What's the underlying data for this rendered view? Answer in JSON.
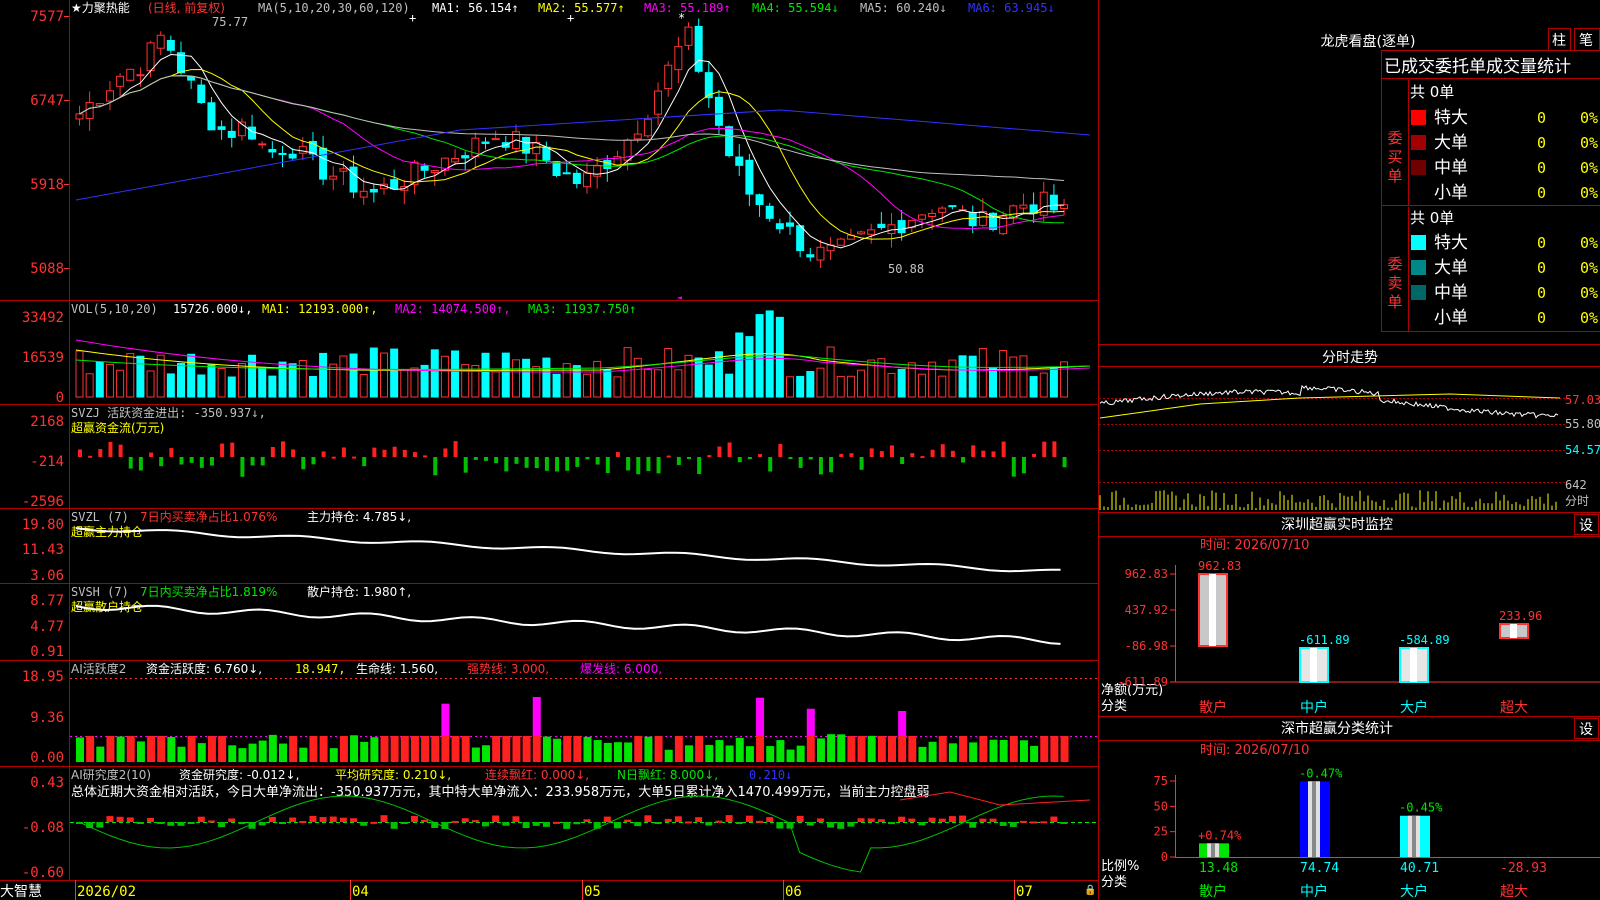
{
  "app": {
    "brand": "大智慧"
  },
  "colors": {
    "up": "#ff3232",
    "down": "#00ffff",
    "green": "#00e600",
    "white": "#ffffff",
    "yellow": "#ffff00",
    "magenta": "#ff00ff",
    "blue": "#3232ff",
    "gray": "#c0c0c0",
    "frame": "#b00000"
  },
  "header": {
    "title": "★力聚热能",
    "mode": "(日线, 前复权)",
    "ma_prefix": "MA(5,10,20,30,60,120)",
    "ma1": "MA1: 56.154↑",
    "ma2": "MA2: 55.577↑",
    "ma3": "MA3: 55.189↑",
    "ma4": "MA4: 55.594↓",
    "ma5": "MA5: 60.240↓",
    "ma6": "MA6: 63.945↓"
  },
  "price_axis": [
    "7577",
    "6747",
    "5918",
    "5088"
  ],
  "price_markers": {
    "high": "75.77",
    "low": "50.88"
  },
  "vol": {
    "axis": [
      "33492",
      "16539",
      "0"
    ],
    "label": "VOL(5,10,20)",
    "value": "15726.000↓,",
    "ma1": "MA1: 12193.000↑,",
    "ma2": "MA2: 14074.500↑,",
    "ma3": "MA3: 11937.750↑"
  },
  "svzj": {
    "axis": [
      "2168",
      "-214",
      "-2596"
    ],
    "label": "SVZJ  活跃资金进出: -350.937↓,",
    "subtitle": "超赢资金流(万元)"
  },
  "svzl": {
    "axis": [
      "19.80",
      "11.43",
      "3.06"
    ],
    "prefix": "SVZL (7)",
    "ratio": "7日内买卖净占比1.076%",
    "holding": "主力持仓: 4.785↓,",
    "subtitle": "超赢主力持仓"
  },
  "svsh": {
    "axis": [
      "8.77",
      "4.77",
      "0.91"
    ],
    "prefix": "SVSH (7)",
    "ratio": "7日内买卖净占比1.819%",
    "holding": "散户持仓: 1.980↑,",
    "subtitle": "超赢散户持仓"
  },
  "ai_active": {
    "axis": [
      "18.95",
      "9.36",
      "0.00"
    ],
    "prefix": "AI活跃度2",
    "v1": "资金活跃度: 6.760↓,",
    "v2": "18.947,",
    "v3": "生命线: 1.560,",
    "v4": "强势线: 3.000,",
    "v5": "爆发线: 6.000,"
  },
  "ai_research": {
    "axis": [
      "0.43",
      "-0.08",
      "-0.60"
    ],
    "prefix": "AI研究度2(10)",
    "v1": "资金研究度: -0.012↓,",
    "v2": "平均研究度: 0.210↓,",
    "v3": "连续飘红: 0.000↓,",
    "v4": "N日飘红: 8.000↓,",
    "v5": "0.210↓",
    "summary": "总体近期大资金相对活跃，今日大单净流出：-350.937万元，其中特大单净流入：233.958万元，大单5日累计净入1470.499万元，当前主力控盘弱"
  },
  "date_axis": [
    "2026/02",
    "04",
    "05",
    "06",
    "07"
  ],
  "right": {
    "lhb_title": "龙虎看盘(逐单)",
    "btn_zhu": "柱",
    "btn_bi": "笔",
    "stats_title": "已成交委托单成交量统计",
    "buy_total": "共 0单",
    "sell_total": "共 0单",
    "buy_side": "委买单",
    "sell_side": "委卖单",
    "buy_rows": [
      {
        "label": "特大",
        "count": "0",
        "pct": "0%",
        "color": "#ff0000"
      },
      {
        "label": "大单",
        "count": "0",
        "pct": "0%",
        "color": "#a00000"
      },
      {
        "label": "中单",
        "count": "0",
        "pct": "0%",
        "color": "#700000"
      },
      {
        "label": "小单",
        "count": "0",
        "pct": "0%",
        "color": "#000000"
      }
    ],
    "sell_rows": [
      {
        "label": "特大",
        "count": "0",
        "pct": "0%",
        "color": "#00ffff"
      },
      {
        "label": "大单",
        "count": "0",
        "pct": "0%",
        "color": "#008888"
      },
      {
        "label": "中单",
        "count": "0",
        "pct": "0%",
        "color": "#006666"
      },
      {
        "label": "小单",
        "count": "0",
        "pct": "0%",
        "color": "#000000"
      }
    ],
    "intraday_title": "分时走势",
    "intraday_axis": [
      "57.03",
      "55.80",
      "54.57"
    ],
    "intraday_vol_axis": [
      "642",
      "分时"
    ],
    "sz_monitor_title": "深圳超赢实时监控",
    "sz_monitor_settings": "设",
    "sz_monitor_time": "时间: 2026/07/10",
    "sz_monitor_axis": [
      "962.83",
      "437.92",
      "-86.98",
      "-611.89"
    ],
    "sz_monitor_ylabel": "净额(万元)",
    "sz_monitor_xlabel": "分类",
    "sz_class_title": "深市超赢分类统计",
    "sz_class_settings": "设",
    "sz_class_time": "时间: 2026/07/10",
    "sz_class_axis": [
      "75",
      "50",
      "25",
      "0"
    ],
    "sz_class_ylabel": "比例%",
    "sz_class_xlabel": "分类"
  },
  "chart_data": [
    {
      "type": "bar",
      "title": "深圳超赢实时监控",
      "ylabel": "净额(万元)",
      "categories": [
        "散户",
        "中户",
        "大户",
        "超大"
      ],
      "values": [
        962.83,
        -611.89,
        -584.89,
        233.96
      ],
      "value_labels": [
        "962.83",
        "-611.89",
        "-584.89",
        "233.96"
      ],
      "ylim": [
        -611.89,
        962.83
      ]
    },
    {
      "type": "bar",
      "title": "深市超赢分类统计",
      "ylabel": "比例%",
      "categories": [
        "散户",
        "中户",
        "大户",
        "超大"
      ],
      "values": [
        0.74,
        -0.47,
        -0.45,
        0
      ],
      "bar_heights": [
        13.48,
        74.74,
        40.71,
        -28.93
      ],
      "value_labels": [
        "+0.74%",
        "-0.47%",
        "-0.45%",
        ""
      ],
      "bottom_labels": [
        "13.48",
        "74.74",
        "40.71",
        "-28.93"
      ],
      "ylim": [
        0,
        75
      ]
    }
  ]
}
